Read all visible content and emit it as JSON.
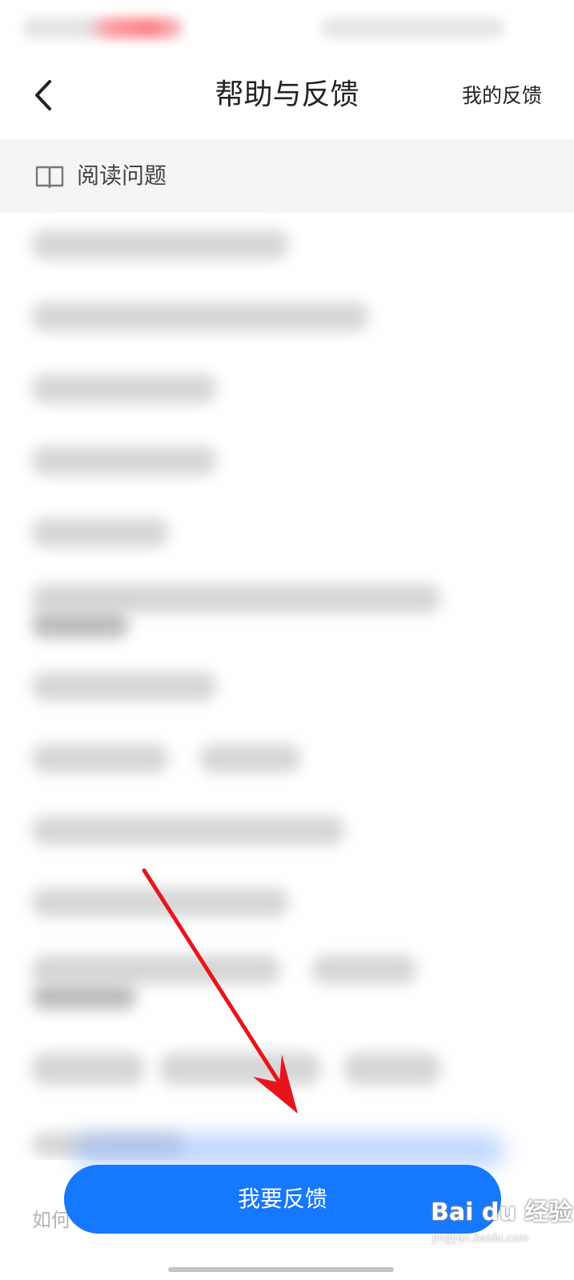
{
  "nav": {
    "title": "帮助与反馈",
    "my_feedback": "我的反馈",
    "back_icon": "chevron-left-icon"
  },
  "section": {
    "title": "阅读问题",
    "icon": "book-open-icon"
  },
  "footer": {
    "hint_text": "如何",
    "feedback_button": "我要反馈"
  },
  "watermark": {
    "logo": "Bai du 经验",
    "subtitle": "jingyan.baidu.com"
  },
  "colors": {
    "primary": "#1677ff",
    "annotation_arrow": "#e8141c",
    "section_bg": "#f5f5f5"
  }
}
